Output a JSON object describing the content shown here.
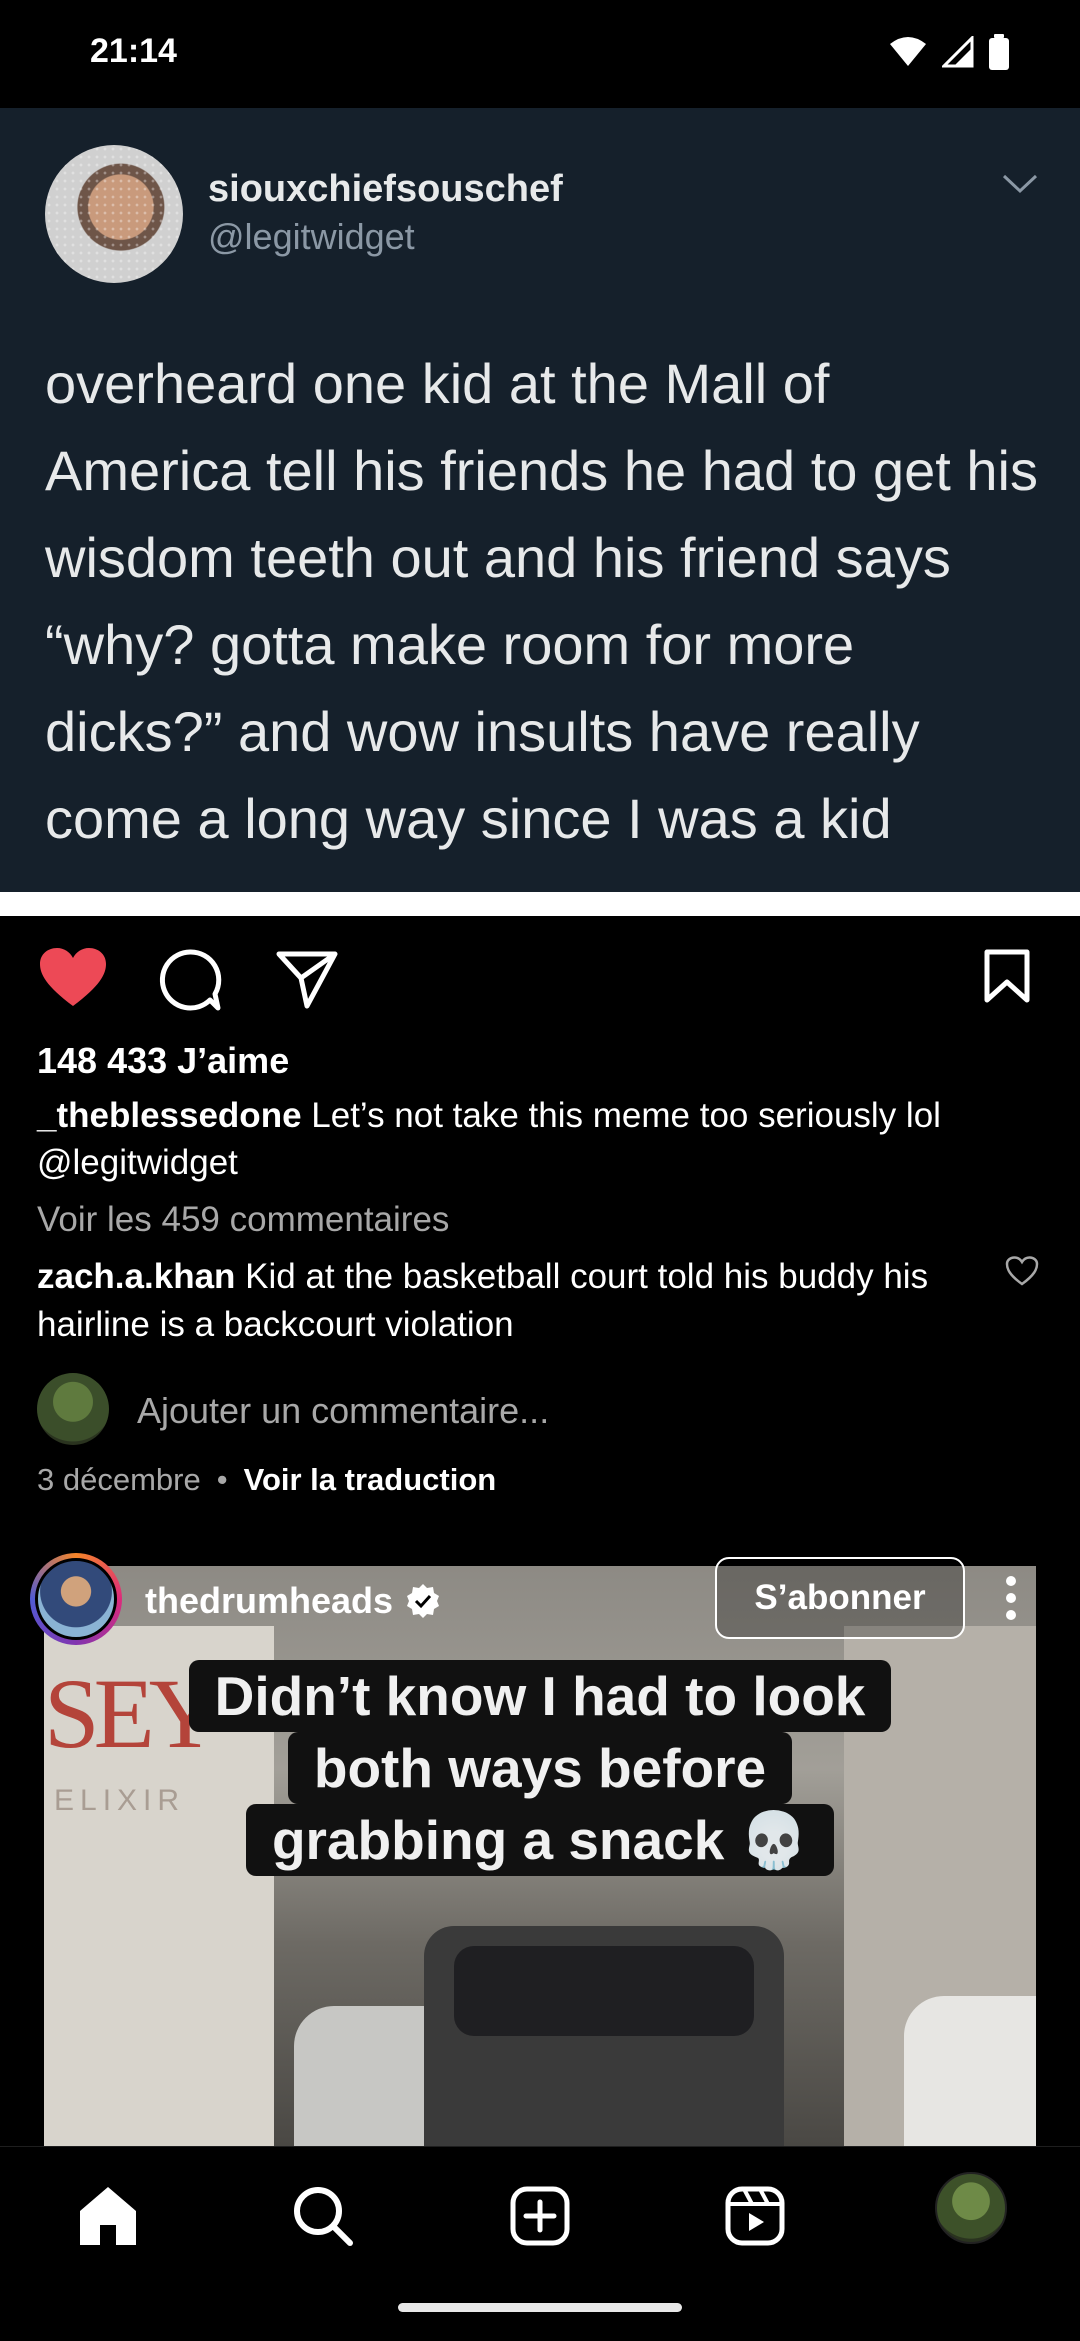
{
  "status_bar": {
    "time": "21:14"
  },
  "tweet": {
    "display_name": "siouxchiefsouschef",
    "handle": "@legitwidget",
    "text": "overheard one kid at the Mall of America tell his friends he had to get his wisdom teeth out and his friend says “why? gotta make room for more dicks?” and wow insults have really come a long way since I was a kid"
  },
  "post": {
    "likes": "148 433 J’aime",
    "caption_user": "_theblessedone",
    "caption_text": "Let’s not take this meme too seriously lol @legitwidget",
    "view_comments": "Voir les 459 commentaires",
    "top_comment_user": "zach.a.khan",
    "top_comment_text": "Kid at the basketball court told his buddy his hairline is a backcourt violation",
    "add_comment_placeholder": "Ajouter un commentaire...",
    "date": "3 décembre",
    "separator": "•",
    "translate": "Voir la traduction"
  },
  "next_post": {
    "username": "thedrumheads",
    "subscribe_label": "S’abonner",
    "overlay_lines": [
      "Didn’t know I had to look",
      "both ways before",
      "grabbing a snack 💀"
    ],
    "sign_text": "SEY",
    "sign_sub": "ELIXIR"
  },
  "colors": {
    "like_red": "#ed4956",
    "tweet_bg": "#15202b"
  },
  "icons": [
    "heart-icon",
    "comment-icon",
    "share-icon",
    "bookmark-icon",
    "home-icon",
    "search-icon",
    "create-icon",
    "reels-icon"
  ]
}
